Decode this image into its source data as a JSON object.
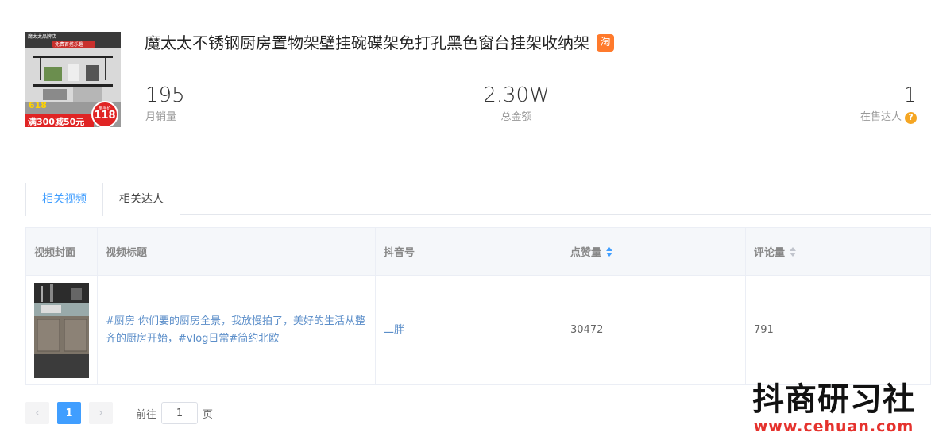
{
  "product": {
    "title": "魔太太不锈钢厨房置物架壁挂碗碟架免打孔黑色窗台挂架收纳架",
    "platform_badge": "淘",
    "thumb_texts": {
      "brand": "魔太太品牌店",
      "banner": "免费百搭乐趣",
      "promo": "满300减50元",
      "price": "118",
      "price_note": "到手价",
      "event": "618"
    }
  },
  "stats": {
    "monthly_sales": {
      "value": "195",
      "label": "月销量"
    },
    "total_amount": {
      "value": "2.30W",
      "label": "总金额"
    },
    "creators": {
      "value": "1",
      "label": "在售达人"
    }
  },
  "tabs": [
    {
      "label": "相关视频",
      "active": true
    },
    {
      "label": "相关达人",
      "active": false
    }
  ],
  "table": {
    "headers": {
      "cover": "视频封面",
      "title": "视频标题",
      "douyin_id": "抖音号",
      "likes": "点赞量",
      "comments": "评论量"
    },
    "rows": [
      {
        "title": "#厨房 你们要的厨房全景，我放慢拍了，美好的生活从整齐的厨房开始，#vlog日常#简约北欧",
        "douyin_id": "二胖",
        "likes": "30472",
        "comments": "791"
      }
    ]
  },
  "pagination": {
    "current": "1",
    "goto_label": "前往",
    "goto_value": "1",
    "page_suffix": "页"
  },
  "watermark": {
    "title": "抖商研习社",
    "url": "www.cehuan.com"
  },
  "colors": {
    "accent": "#409eff",
    "taobao": "#ff7a2c",
    "help": "#f5a623",
    "watermark_url": "#e5322d"
  }
}
